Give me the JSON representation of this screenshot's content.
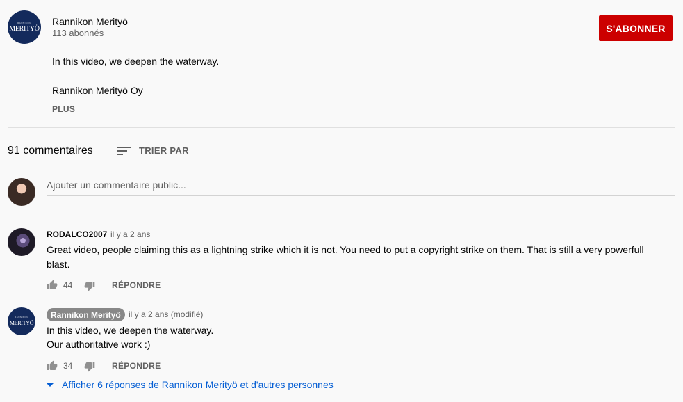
{
  "channel": {
    "name": "Rannikon Merityö",
    "subscribers": "113 abonnés",
    "logo_text": "MERITYÖ",
    "logo_small_text": "RANNIKON",
    "subscribe_label": "S'ABONNER"
  },
  "description": {
    "line1": "In this video, we deepen the waterway.",
    "line2": "Rannikon Merityö Oy",
    "more_label": "PLUS"
  },
  "comments_header": {
    "count": "91 commentaires",
    "sort_label": "TRIER PAR"
  },
  "new_comment": {
    "placeholder": "Ajouter un commentaire public..."
  },
  "comments": [
    {
      "author": "RODALCO2007",
      "time": "il y a 2 ans",
      "text": "Great video, people claiming this as a lightning strike which it is not. You need to put a copyright strike on them. That is still a very powerfull blast.",
      "likes": "44",
      "reply_label": "RÉPONDRE"
    },
    {
      "author": "Rannikon Merityö",
      "time": "il y a 2 ans (modifié)",
      "text_line1": "In this video, we deepen the waterway.",
      "text_line2": "Our authoritative work :)",
      "likes": "34",
      "reply_label": "RÉPONDRE",
      "replies_label": "Afficher 6 réponses de Rannikon Merityö et d'autres personnes"
    }
  ],
  "colors": {
    "subscribe": "#cc0000",
    "link": "#065fd4",
    "secondary_text": "#606060"
  }
}
